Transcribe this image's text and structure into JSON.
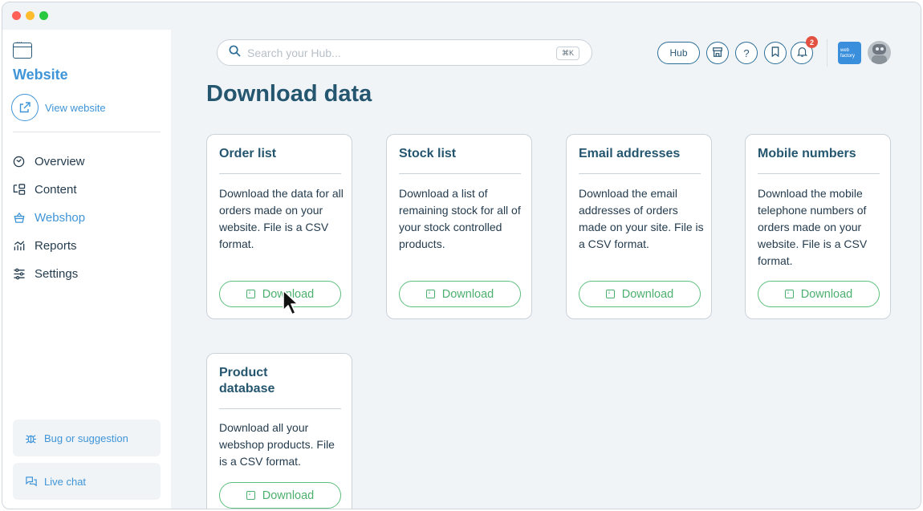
{
  "sidebar": {
    "title": "Website",
    "view_website": "View website",
    "nav": [
      {
        "label": "Overview",
        "icon": "overview-icon",
        "active": false
      },
      {
        "label": "Content",
        "icon": "content-icon",
        "active": false
      },
      {
        "label": "Webshop",
        "icon": "webshop-icon",
        "active": true
      },
      {
        "label": "Reports",
        "icon": "reports-icon",
        "active": false
      },
      {
        "label": "Settings",
        "icon": "settings-icon",
        "active": false
      }
    ],
    "bug_label": "Bug or suggestion",
    "chat_label": "Live chat"
  },
  "topbar": {
    "search_placeholder": "Search your Hub...",
    "search_shortcut": "⌘K",
    "hub_label": "Hub",
    "notification_count": "2",
    "logo_text": "web factory"
  },
  "main": {
    "title": "Download data",
    "cards": [
      {
        "title": "Order list",
        "description": "Download the data for all orders made on your website. File is a CSV format.",
        "button": "Download"
      },
      {
        "title": "Stock list",
        "description": "Download a list of remaining stock for all of your stock controlled products.",
        "button": "Download"
      },
      {
        "title": "Email addresses",
        "description": "Download the email addresses of orders made on your site. File is a CSV format.",
        "button": "Download"
      },
      {
        "title": "Mobile numbers",
        "description": "Download the mobile telephone numbers of orders made on your website. File is a CSV format.",
        "button": "Download"
      },
      {
        "title": "Product database",
        "description": "Download all your webshop products. File is a CSV format.",
        "button": "Download"
      }
    ]
  },
  "colors": {
    "accent_blue": "#3f95d8",
    "title_navy": "#25566f",
    "download_green": "#4bb06d",
    "badge_red": "#e25141"
  }
}
